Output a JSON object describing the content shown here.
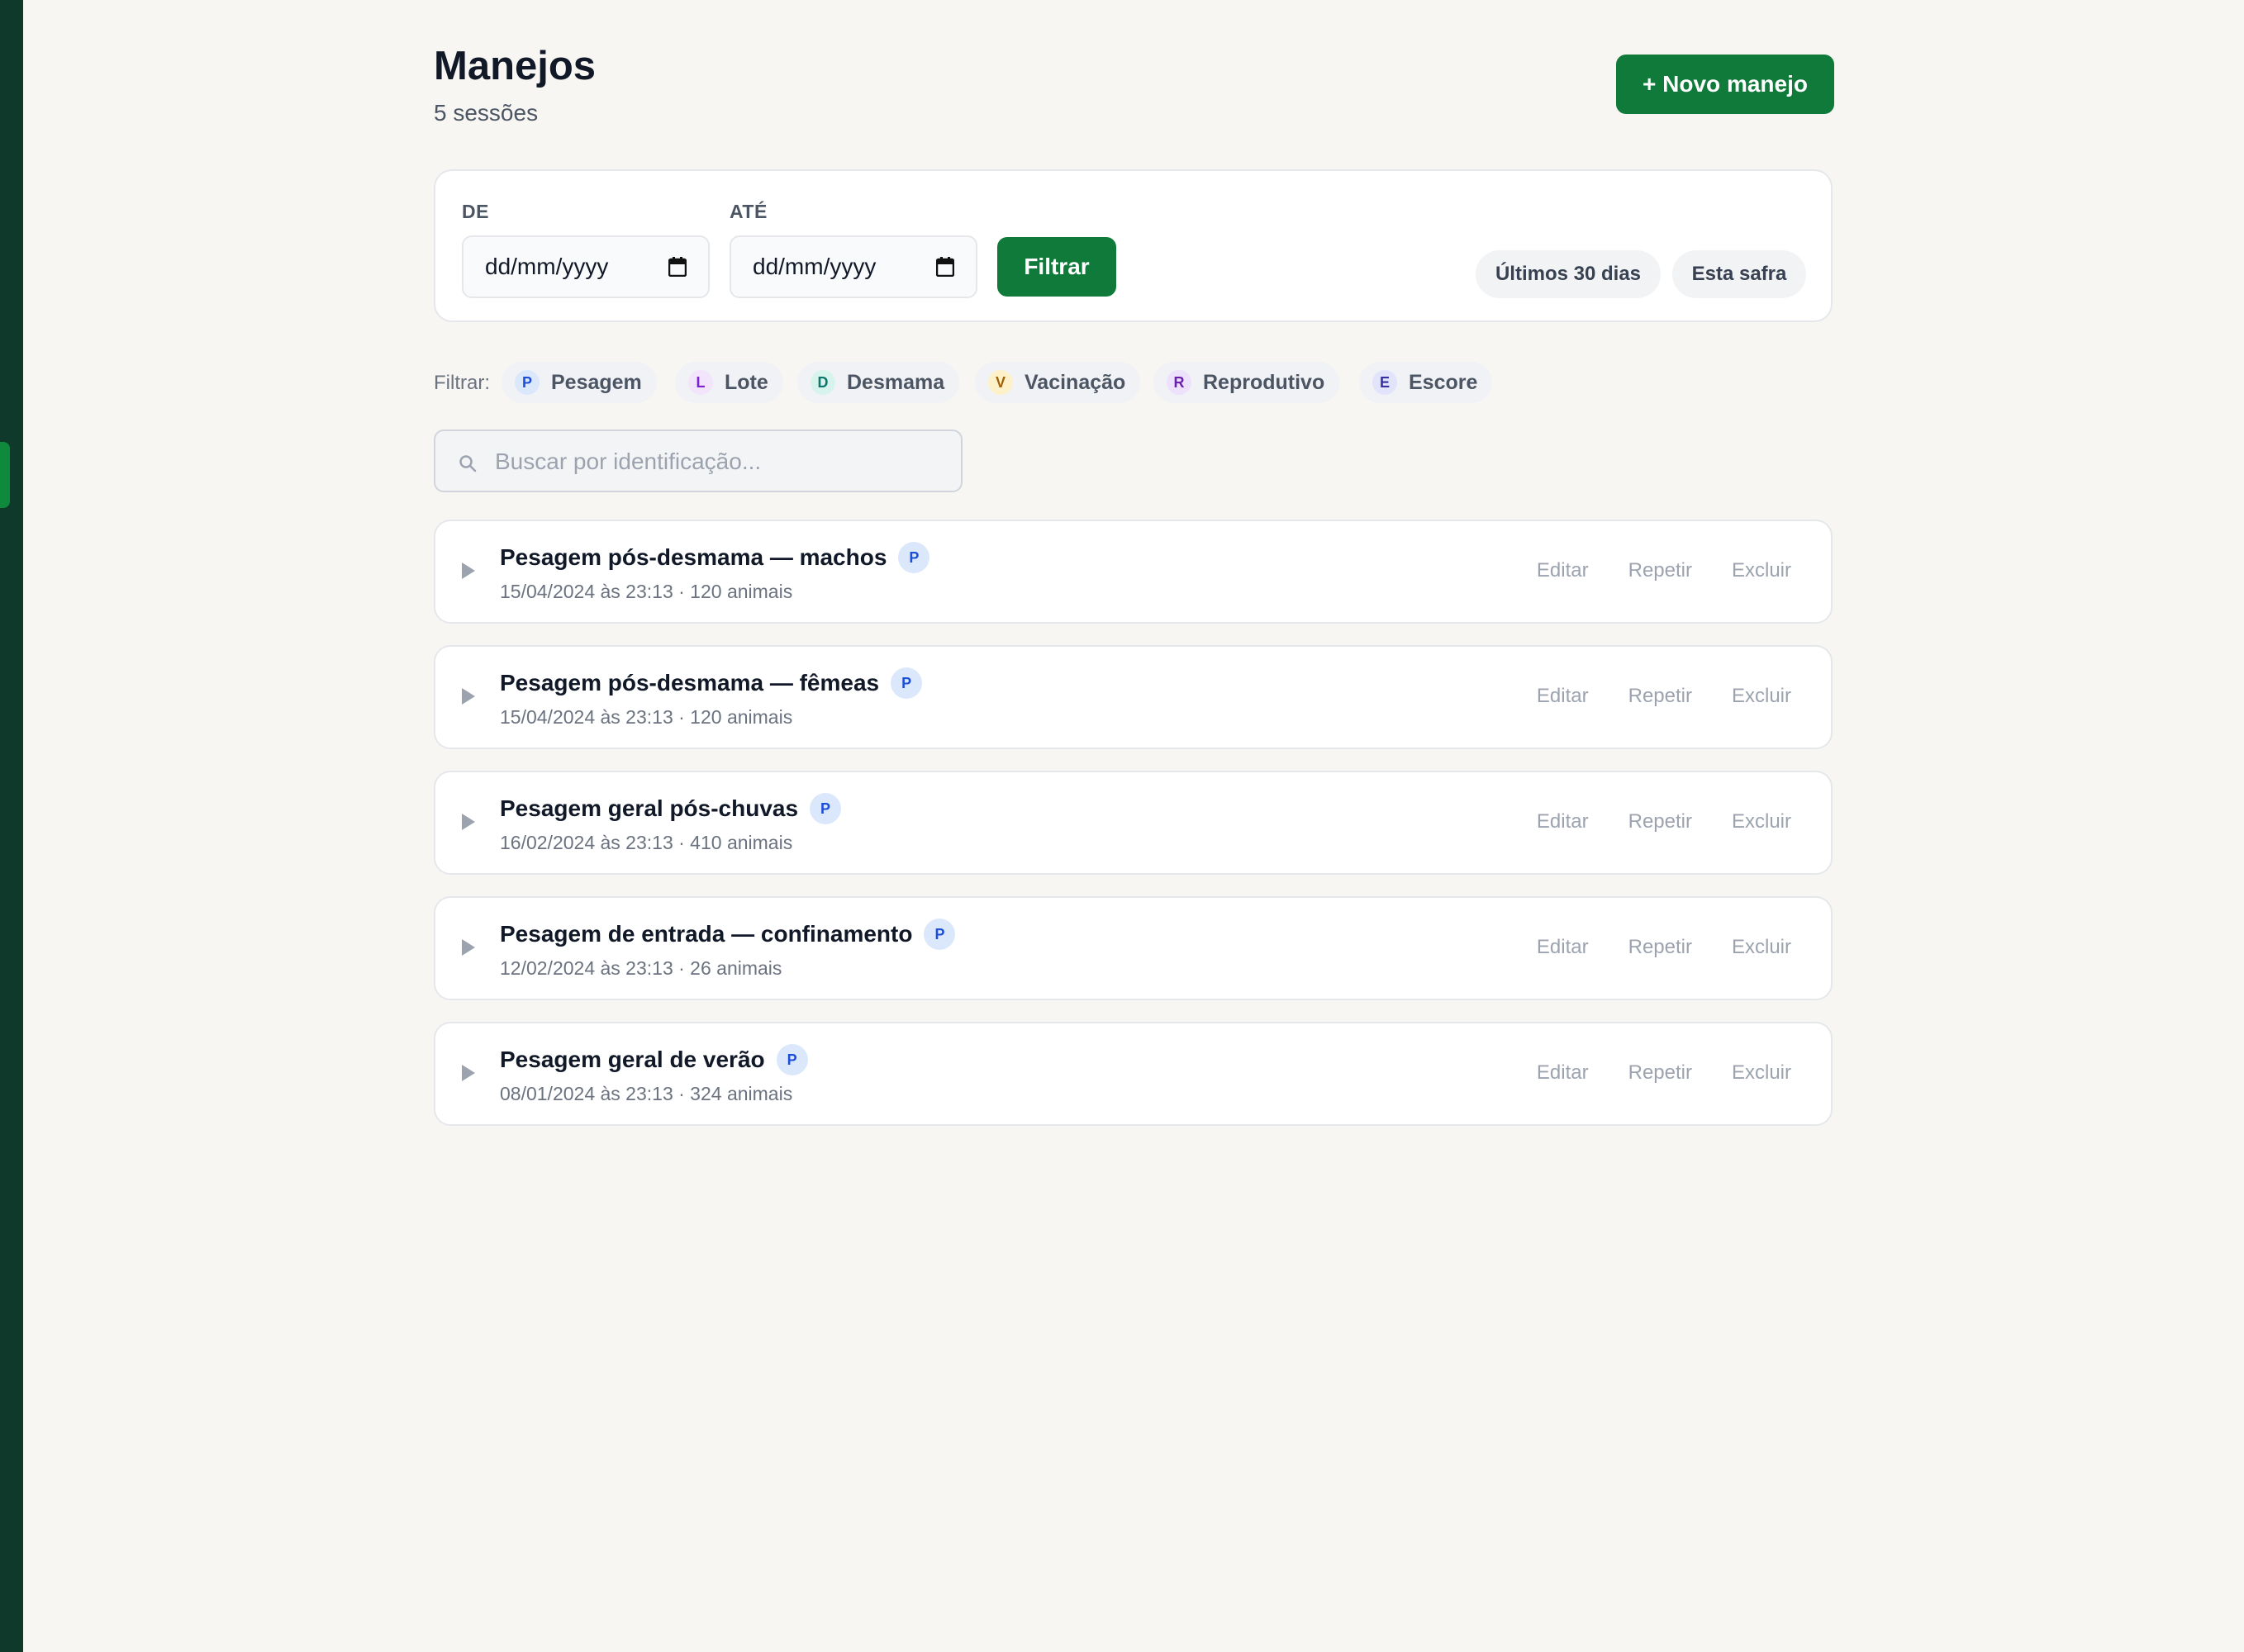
{
  "header": {
    "title": "Manejos",
    "subtitle": "5 sessões",
    "new_button": "+ Novo manejo"
  },
  "filters": {
    "from_label": "DE",
    "to_label": "ATÉ",
    "from_value": "dd/mm/yyyy",
    "to_value": "dd/mm/yyyy",
    "filter_button": "Filtrar",
    "quick": [
      "Últimos 30 dias",
      "Esta safra"
    ]
  },
  "type_filter": {
    "label": "Filtrar:",
    "chips": [
      {
        "badge": "P",
        "label": "Pesagem",
        "color": "#1d4ed8",
        "bg": "#dbe8fb"
      },
      {
        "badge": "L",
        "label": "Lote",
        "color": "#7e22ce",
        "bg": "#f1e4fb"
      },
      {
        "badge": "D",
        "label": "Desmama",
        "color": "#0f766e",
        "bg": "#d6f4ec"
      },
      {
        "badge": "V",
        "label": "Vacinação",
        "color": "#a16207",
        "bg": "#fdf1c9"
      },
      {
        "badge": "R",
        "label": "Reprodutivo",
        "color": "#6b21a8",
        "bg": "#ede1fb"
      },
      {
        "badge": "E",
        "label": "Escore",
        "color": "#3730a3",
        "bg": "#e2e4fb"
      }
    ]
  },
  "search": {
    "placeholder": "Buscar por identificação..."
  },
  "actions": {
    "edit": "Editar",
    "repeat": "Repetir",
    "delete": "Excluir"
  },
  "sessions": [
    {
      "title": "Pesagem pós-desmama — machos",
      "badge": "P",
      "meta": "15/04/2024 às 23:13 · 120 animais"
    },
    {
      "title": "Pesagem pós-desmama — fêmeas",
      "badge": "P",
      "meta": "15/04/2024 às 23:13 · 120 animais"
    },
    {
      "title": "Pesagem geral pós-chuvas",
      "badge": "P",
      "meta": "16/02/2024 às 23:13 · 410 animais"
    },
    {
      "title": "Pesagem de entrada — confinamento",
      "badge": "P",
      "meta": "12/02/2024 às 23:13 · 26 animais"
    },
    {
      "title": "Pesagem geral de verão",
      "badge": "P",
      "meta": "08/01/2024 às 23:13 · 324 animais"
    }
  ]
}
